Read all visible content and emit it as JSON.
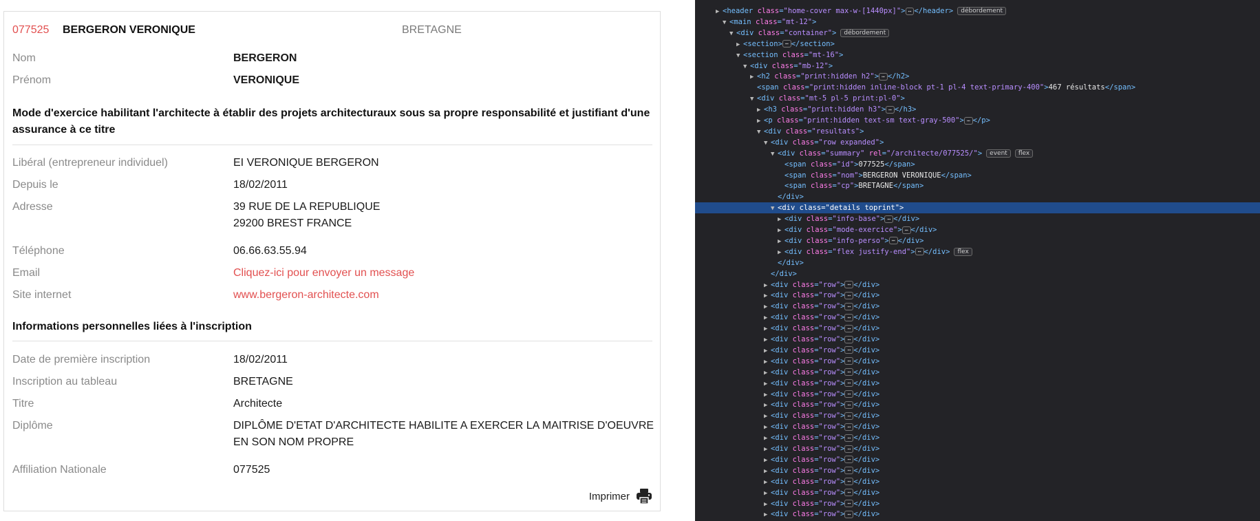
{
  "summary": {
    "id": "077525",
    "name": "BERGERON VERONIQUE",
    "region": "BRETAGNE"
  },
  "info_base": [
    {
      "label": "Nom",
      "value": "BERGERON"
    },
    {
      "label": "Prénom",
      "value": "VERONIQUE"
    }
  ],
  "mode_exercice": {
    "title": "Mode d'exercice habilitant l'architecte à établir des projets architecturaux sous sa propre responsabilité et justifiant d'une assurance à ce titre",
    "rows": [
      {
        "label": "Libéral (entrepreneur individuel)",
        "value": "EI VERONIQUE BERGERON"
      },
      {
        "label": "Depuis le",
        "value": "18/02/2011"
      },
      {
        "label": "Adresse",
        "value": "39 RUE DE LA REPUBLIQUE",
        "value2": "29200 BREST FRANCE"
      },
      {
        "label": "Téléphone",
        "value": "06.66.63.55.94"
      },
      {
        "label": "Email",
        "value": "Cliquez-ici pour envoyer un message"
      },
      {
        "label": "Site internet",
        "value": "www.bergeron-architecte.com"
      }
    ]
  },
  "info_perso": {
    "title": "Informations personnelles liées à l'inscription",
    "rows": [
      {
        "label": "Date de première inscription",
        "value": "18/02/2011"
      },
      {
        "label": "Inscription au tableau",
        "value": "BRETAGNE"
      },
      {
        "label": "Titre",
        "value": "Architecte"
      },
      {
        "label": "Diplôme",
        "value": "DIPLÔME D'ETAT D'ARCHITECTE HABILITE A EXERCER LA MAITRISE D'OEUVRE EN SON NOM PROPRE"
      },
      {
        "label": "Affiliation Nationale",
        "value": "077525"
      }
    ]
  },
  "print": {
    "label": "Imprimer",
    "icon": "printer-icon"
  },
  "colors": {
    "accent": "#e25050",
    "label": "#8a8a8a",
    "devtools_bg": "#232327",
    "selection": "#204c8c"
  },
  "devtools": {
    "ellipsis": "⋯",
    "badges": {
      "overflow": "débordement",
      "event": "event",
      "flex": "flex"
    },
    "lines": [
      {
        "tw": "▶",
        "parts": [
          [
            "tag",
            "<header "
          ],
          [
            "attr",
            "class"
          ],
          [
            "tag",
            "="
          ],
          [
            "aval",
            "\"home-cover max-w-[1440px]\""
          ],
          [
            "tag",
            ">"
          ],
          [
            "ell",
            ""
          ],
          [
            "tag",
            "</header>"
          ]
        ],
        "badges": [
          "overflow"
        ]
      },
      {
        "tw": "▼",
        "parts": [
          [
            "tag",
            "<main "
          ],
          [
            "attr",
            "class"
          ],
          [
            "tag",
            "="
          ],
          [
            "aval",
            "\"mt-12\""
          ],
          [
            "tag",
            ">"
          ]
        ],
        "badges": []
      },
      {
        "tw": "▼",
        "parts": [
          [
            "tag",
            "<div "
          ],
          [
            "attr",
            "class"
          ],
          [
            "tag",
            "="
          ],
          [
            "aval",
            "\"container\""
          ],
          [
            "tag",
            ">"
          ]
        ],
        "badges": [
          "overflow"
        ]
      },
      {
        "tw": "▶",
        "parts": [
          [
            "tag",
            "<section>"
          ],
          [
            "ell",
            ""
          ],
          [
            "tag",
            "</section>"
          ]
        ],
        "badges": []
      },
      {
        "tw": "▼",
        "parts": [
          [
            "tag",
            "<section "
          ],
          [
            "attr",
            "class"
          ],
          [
            "tag",
            "="
          ],
          [
            "aval",
            "\"mt-16\""
          ],
          [
            "tag",
            ">"
          ]
        ],
        "badges": []
      },
      {
        "tw": "▼",
        "parts": [
          [
            "tag",
            "<div "
          ],
          [
            "attr",
            "class"
          ],
          [
            "tag",
            "="
          ],
          [
            "aval",
            "\"mb-12\""
          ],
          [
            "tag",
            ">"
          ]
        ],
        "badges": []
      },
      {
        "tw": "▶",
        "parts": [
          [
            "tag",
            "<h2 "
          ],
          [
            "attr",
            "class"
          ],
          [
            "tag",
            "="
          ],
          [
            "aval",
            "\"print:hidden h2\""
          ],
          [
            "tag",
            ">"
          ],
          [
            "ell",
            ""
          ],
          [
            "tag",
            "</h2>"
          ]
        ],
        "badges": []
      },
      {
        "tw": "",
        "parts": [
          [
            "tag",
            "<span "
          ],
          [
            "attr",
            "class"
          ],
          [
            "tag",
            "="
          ],
          [
            "aval",
            "\"print:hidden inline-block pt-1 pl-4 text-primary-400\""
          ],
          [
            "tag",
            ">"
          ],
          [
            "txt",
            "467 résultats"
          ],
          [
            "tag",
            "</span>"
          ]
        ],
        "badges": []
      },
      {
        "tw": "▼",
        "parts": [
          [
            "tag",
            "<div "
          ],
          [
            "attr",
            "class"
          ],
          [
            "tag",
            "="
          ],
          [
            "aval",
            "\"mt-5 pl-5 print:pl-0\""
          ],
          [
            "tag",
            ">"
          ]
        ],
        "badges": []
      },
      {
        "tw": "▶",
        "parts": [
          [
            "tag",
            "<h3 "
          ],
          [
            "attr",
            "class"
          ],
          [
            "tag",
            "="
          ],
          [
            "aval",
            "\"print:hidden h3\""
          ],
          [
            "tag",
            ">"
          ],
          [
            "ell",
            ""
          ],
          [
            "tag",
            "</h3>"
          ]
        ],
        "badges": []
      },
      {
        "tw": "▶",
        "parts": [
          [
            "tag",
            "<p "
          ],
          [
            "attr",
            "class"
          ],
          [
            "tag",
            "="
          ],
          [
            "aval",
            "\"print:hidden text-sm text-gray-500\""
          ],
          [
            "tag",
            ">"
          ],
          [
            "ell",
            ""
          ],
          [
            "tag",
            "</p>"
          ]
        ],
        "badges": []
      },
      {
        "tw": "▼",
        "parts": [
          [
            "tag",
            "<div "
          ],
          [
            "attr",
            "class"
          ],
          [
            "tag",
            "="
          ],
          [
            "aval",
            "\"resultats\""
          ],
          [
            "tag",
            ">"
          ]
        ],
        "badges": []
      },
      {
        "tw": "▼",
        "parts": [
          [
            "tag",
            "<div "
          ],
          [
            "attr",
            "class"
          ],
          [
            "tag",
            "="
          ],
          [
            "aval",
            "\"row expanded\""
          ],
          [
            "tag",
            ">"
          ]
        ],
        "badges": []
      },
      {
        "tw": "▼",
        "parts": [
          [
            "tag",
            "<div "
          ],
          [
            "attr",
            "class"
          ],
          [
            "tag",
            "="
          ],
          [
            "aval",
            "\"summary\""
          ],
          [
            "tag",
            " "
          ],
          [
            "attr",
            "rel"
          ],
          [
            "tag",
            "="
          ],
          [
            "aval",
            "\"/architecte/077525/\""
          ],
          [
            "tag",
            ">"
          ]
        ],
        "badges": [
          "event",
          "flex"
        ]
      },
      {
        "tw": "",
        "parts": [
          [
            "tag",
            "<span "
          ],
          [
            "attr",
            "class"
          ],
          [
            "tag",
            "="
          ],
          [
            "aval",
            "\"id\""
          ],
          [
            "tag",
            ">"
          ],
          [
            "txt",
            "077525"
          ],
          [
            "tag",
            "</span>"
          ]
        ],
        "badges": []
      },
      {
        "tw": "",
        "parts": [
          [
            "tag",
            "<span "
          ],
          [
            "attr",
            "class"
          ],
          [
            "tag",
            "="
          ],
          [
            "aval",
            "\"nom\""
          ],
          [
            "tag",
            ">"
          ],
          [
            "txt",
            "BERGERON VERONIQUE"
          ],
          [
            "tag",
            "</span>"
          ]
        ],
        "badges": []
      },
      {
        "tw": "",
        "parts": [
          [
            "tag",
            "<span "
          ],
          [
            "attr",
            "class"
          ],
          [
            "tag",
            "="
          ],
          [
            "aval",
            "\"cp\""
          ],
          [
            "tag",
            ">"
          ],
          [
            "txt",
            "BRETAGNE"
          ],
          [
            "tag",
            "</span>"
          ]
        ],
        "badges": []
      },
      {
        "tw": "",
        "parts": [
          [
            "tag",
            "</div>"
          ]
        ],
        "badges": []
      },
      {
        "tw": "▼",
        "parts": [
          [
            "tag",
            "<div "
          ],
          [
            "attr",
            "class"
          ],
          [
            "tag",
            "="
          ],
          [
            "aval",
            "\"details toprint\""
          ],
          [
            "tag",
            ">"
          ]
        ],
        "badges": [],
        "selected": true
      },
      {
        "tw": "▶",
        "parts": [
          [
            "tag",
            "<div "
          ],
          [
            "attr",
            "class"
          ],
          [
            "tag",
            "="
          ],
          [
            "aval",
            "\"info-base\""
          ],
          [
            "tag",
            ">"
          ],
          [
            "ell",
            ""
          ],
          [
            "tag",
            "</div>"
          ]
        ],
        "badges": []
      },
      {
        "tw": "▶",
        "parts": [
          [
            "tag",
            "<div "
          ],
          [
            "attr",
            "class"
          ],
          [
            "tag",
            "="
          ],
          [
            "aval",
            "\"mode-exercice\""
          ],
          [
            "tag",
            ">"
          ],
          [
            "ell",
            ""
          ],
          [
            "tag",
            "</div>"
          ]
        ],
        "badges": []
      },
      {
        "tw": "▶",
        "parts": [
          [
            "tag",
            "<div "
          ],
          [
            "attr",
            "class"
          ],
          [
            "tag",
            "="
          ],
          [
            "aval",
            "\"info-perso\""
          ],
          [
            "tag",
            ">"
          ],
          [
            "ell",
            ""
          ],
          [
            "tag",
            "</div>"
          ]
        ],
        "badges": []
      },
      {
        "tw": "▶",
        "parts": [
          [
            "tag",
            "<div "
          ],
          [
            "attr",
            "class"
          ],
          [
            "tag",
            "="
          ],
          [
            "aval",
            "\"flex justify-end\""
          ],
          [
            "tag",
            ">"
          ],
          [
            "ell",
            ""
          ],
          [
            "tag",
            "</div>"
          ]
        ],
        "badges": [
          "flex"
        ]
      },
      {
        "tw": "",
        "parts": [
          [
            "tag",
            "</div>"
          ]
        ],
        "badges": []
      },
      {
        "tw": "",
        "parts": [
          [
            "tag",
            "</div>"
          ]
        ],
        "badges": []
      }
    ],
    "row_line": [
      [
        "tag",
        "<div "
      ],
      [
        "attr",
        "class"
      ],
      [
        "tag",
        "="
      ],
      [
        "aval",
        "\"row\""
      ],
      [
        "tag",
        ">"
      ],
      [
        "ell",
        ""
      ],
      [
        "tag",
        "</div>"
      ]
    ],
    "row_count": 22
  }
}
